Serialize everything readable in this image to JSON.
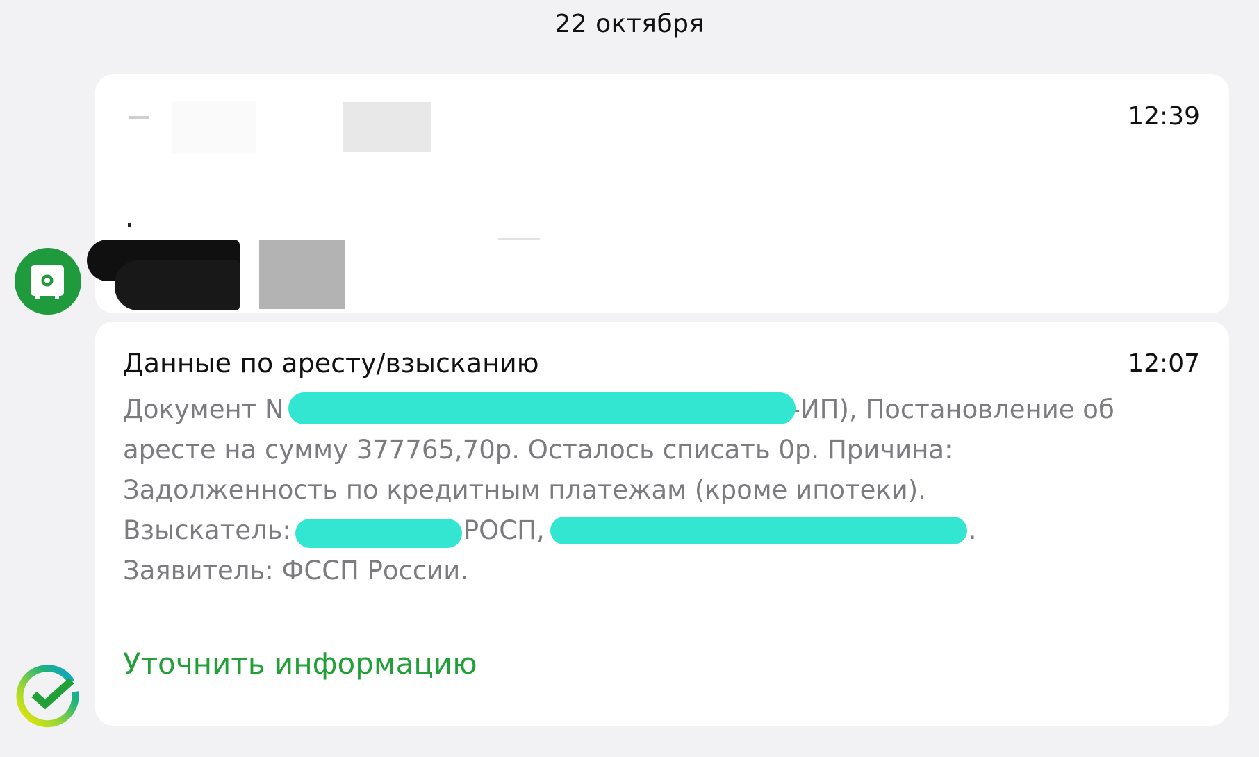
{
  "date_header": "22 октября",
  "messages": [
    {
      "time": "12:39",
      "redacted": true
    },
    {
      "time": "12:07",
      "title": "Данные по аресту/взысканию",
      "body": {
        "line1_start": "Документ N",
        "line1_end": "-ИП), Постановление об",
        "line2": "аресте на сумму 377765,70р. Осталось списать 0р. Причина:",
        "line3": "Задолженность по кредитным платежам (кроме ипотеки).",
        "line4_start": "Взыскатель:",
        "line4_mid": "РОСП,",
        "line4_end": ".",
        "line5": "Заявитель: ФССП России."
      },
      "action_label": "Уточнить информацию"
    }
  ],
  "colors": {
    "background": "#f2f2f4",
    "card": "#ffffff",
    "brand_green": "#21a038",
    "avatar_green": "#1f9a3c",
    "redaction_marker": "#33e6d2",
    "body_text": "#7b7b80"
  },
  "icons": {
    "sender_avatar": "safe-icon",
    "brand_logo": "sber-logo-icon"
  }
}
